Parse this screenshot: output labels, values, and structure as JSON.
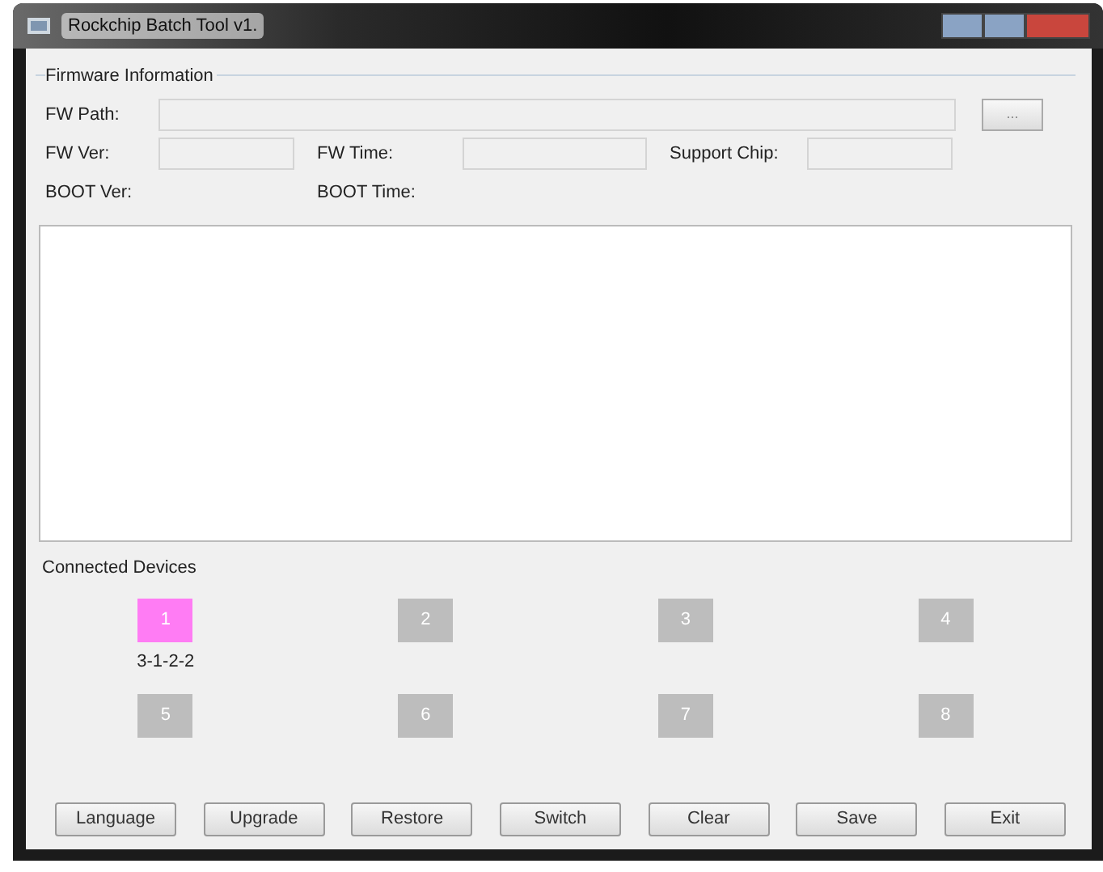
{
  "window": {
    "title": "Rockchip Batch Tool v1."
  },
  "firmware_information": {
    "title": "Firmware Information",
    "fw_path": {
      "label": "FW Path:",
      "browse_button": "..."
    },
    "fields": [
      {
        "label": "FW Ver:",
        "bordered": true
      },
      {
        "label": "FW Time:",
        "bordered": true
      },
      {
        "label": "Support Chip:",
        "bordered": true
      },
      {
        "label": "BOOT Ver:",
        "bordered": false
      },
      {
        "label": "BOOT Time:",
        "bordered": false
      }
    ]
  },
  "connected_devices": {
    "title": "Connected Devices",
    "devices": [
      {
        "number": "1",
        "connected": true,
        "location": "3-1-2-2"
      },
      {
        "number": "2",
        "connected": false
      },
      {
        "number": "3",
        "connected": false
      },
      {
        "number": "4",
        "connected": false
      },
      {
        "number": "5",
        "connected": false
      },
      {
        "number": "6",
        "connected": false
      },
      {
        "number": "7",
        "connected": false
      },
      {
        "number": "8",
        "connected": false
      }
    ]
  },
  "buttons": [
    "Language",
    "Upgrade",
    "Restore",
    "Switch",
    "Clear",
    "Save",
    "Exit"
  ]
}
